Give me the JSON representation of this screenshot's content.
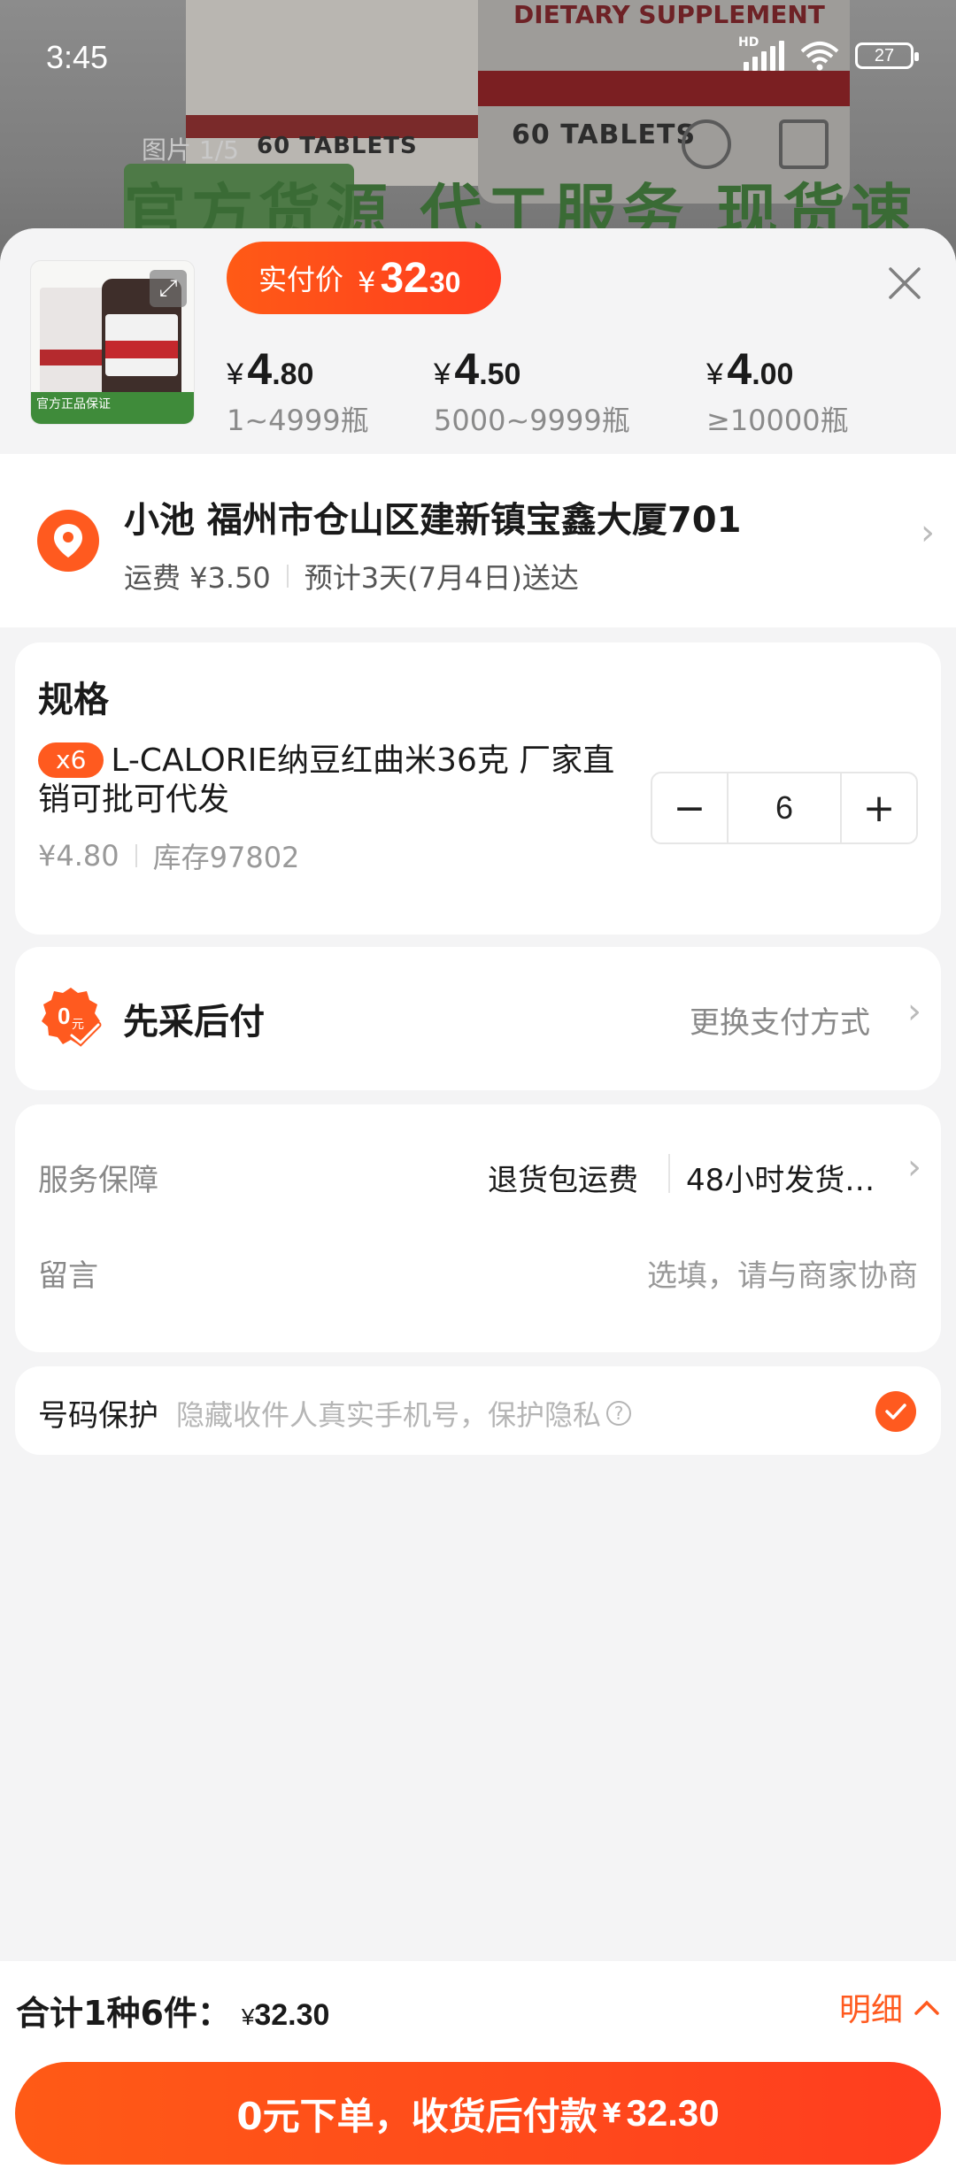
{
  "status_bar": {
    "time": "3:45",
    "battery": "27",
    "network_label": "HD"
  },
  "backdrop": {
    "image_counter": "图片 1/5",
    "tablets_text": "60 TABLETS",
    "supplement_text": "DIETARY SUPPLEMENT",
    "banner_text": "官方货源 代工服务 现货速发"
  },
  "header": {
    "pay_label": "实付价",
    "pay_currency": "¥",
    "pay_int": "32",
    "pay_dec": ".30",
    "thumb_badge": "官方正品保证"
  },
  "price_tiers": [
    {
      "currency": "¥",
      "int": "4",
      "dec": ".80",
      "range": "1~4999瓶"
    },
    {
      "currency": "¥",
      "int": "4",
      "dec": ".50",
      "range": "5000~9999瓶"
    },
    {
      "currency": "¥",
      "int": "4",
      "dec": ".00",
      "range": "≥10000瓶"
    }
  ],
  "address": {
    "name_line": "小池 福州市仓山区建新镇宝鑫大厦701",
    "shipping": "运费 ¥3.50",
    "eta": "预计3天(7月4日)送达"
  },
  "spec": {
    "title": "规格",
    "qty_badge": "x6",
    "name": "L-CALORIE纳豆红曲米36克 厂家直销可批可代发",
    "unit_price": "¥4.80",
    "stock": "库存97802",
    "quantity": "6",
    "minus": "−",
    "plus": "+"
  },
  "payment": {
    "title": "先采后付",
    "change_label": "更换支付方式",
    "icon_text": "0元"
  },
  "service": {
    "label": "服务保障",
    "item1": "退货包运费",
    "item2": "48小时发货…",
    "note_label": "留言",
    "note_placeholder": "选填，请与商家协商"
  },
  "privacy": {
    "label": "号码保护",
    "desc": "隐藏收件人真实手机号，保护隐私",
    "checked": true
  },
  "footer": {
    "total_label": "合计1种6件：",
    "total_currency": "¥",
    "total_amount": "32.30",
    "detail_label": "明细",
    "cta_label": "0元下单，收货后付款",
    "cta_currency": "¥",
    "cta_amount": "32.30"
  },
  "colors": {
    "accent": "#ff5a1f",
    "accent_dark": "#ff3d1f",
    "background": "#f4f4f5"
  }
}
